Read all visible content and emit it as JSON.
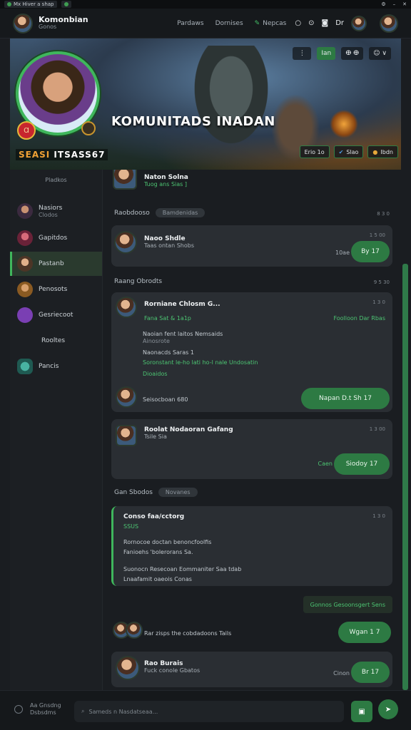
{
  "tabstrip": {
    "tab1": "Mx Hiver a shap",
    "tab2": ""
  },
  "topbar": {
    "title": "Komonbian",
    "subtitle": "Gonos",
    "nav1": "Pardaws",
    "nav2": "Dornises",
    "nav3": "Nepcas",
    "icons": [
      "○",
      "⊙",
      "◙",
      "Dr"
    ]
  },
  "hero": {
    "title": "KOMUNITADS INADAN",
    "badge": "Ɑ",
    "sub_orange": "SEASI",
    "sub_white": "ITSASS67",
    "actions": [
      "⋮",
      "Ian",
      "ⴲ ⴲ",
      "☺ ∨"
    ],
    "tools": [
      "Erio 1o",
      "Slao",
      "Ibdn"
    ]
  },
  "sidebar": {
    "header": "Pladkos",
    "items": [
      {
        "label": "Nasiors",
        "sub": "Clodos"
      },
      {
        "label": "Gapitdos",
        "sub": ""
      },
      {
        "label": "Pastanb",
        "sub": ""
      },
      {
        "label": "Penosots",
        "sub": ""
      },
      {
        "label": "Gesriecoot",
        "sub": ""
      },
      {
        "label": "Rooltes",
        "sub": ""
      },
      {
        "label": "Pancis",
        "sub": ""
      }
    ]
  },
  "feed": {
    "profile": {
      "name": "Naton Solna",
      "meta": "Tuog ans  Sias ]"
    },
    "sec1": {
      "label": "Raobdooso",
      "chip": "Bamdenidas",
      "time": "8 3 0"
    },
    "card1": {
      "name": "Naoo Shdle",
      "meta": "Taas ontan Shobs",
      "time": "1 5 00",
      "right": "10ae",
      "btn": "By 17"
    },
    "sec2": {
      "label": "Raang Obrodts",
      "time": "9 5 30"
    },
    "card2": {
      "name": "Rorniane Chlosm  G...",
      "meta_green": "Fana Sat & 1a1p",
      "right_green": "Foolloon Dar Rbas",
      "time": "1 3 0",
      "lines": [
        "Naoian fent laitos Nemsaids",
        "Ainosrote",
        "Naonacds Saras  1",
        "Soronstant le-ho lati ho-l nale Undosatin",
        "Dioaidos"
      ],
      "footer": "Seisocboan 680",
      "btn": "Napan D.t  Sh 17"
    },
    "card3": {
      "name": "Roolat Nodaoran Gafang",
      "meta": "Tsile  Sia",
      "time": "1 3 00",
      "left_btn": "Caen",
      "btn": "Siodoy 17"
    },
    "sec3": {
      "label": "Gan Sbodos",
      "chip": "Novanes"
    },
    "card4": {
      "title": "Conso faa/cctorg",
      "sub": "SSUS",
      "l1": "Rornocoe doctan benoncfoolfis",
      "l2": "Fanioehs 'bolerorans Sa.",
      "l3": "Suonocn Resecoan Eommaniter Saa tdab",
      "l4": "Lnaafamit oaeois Conas",
      "time": "1 3 0"
    },
    "tag": "Gonnos Gesoonsgert Sens",
    "card5": {
      "name": "Rar zisps the cobdadoons Tails",
      "btn": "Wgan 1 7"
    },
    "card6": {
      "name": "Rao Burais",
      "meta": "Fuck conole Gbatos",
      "right": "Cinon",
      "btn": "Br 17"
    }
  },
  "footer": {
    "left1": "Aa Gnsdng",
    "left2": "Dsbsdms",
    "placeholder": "Sameds n Nasdatseaa..."
  },
  "colors": {
    "accent": "#2d7a43",
    "accent_light": "#4cc472",
    "bg": "#1a1d21",
    "card": "#2a2e33"
  }
}
